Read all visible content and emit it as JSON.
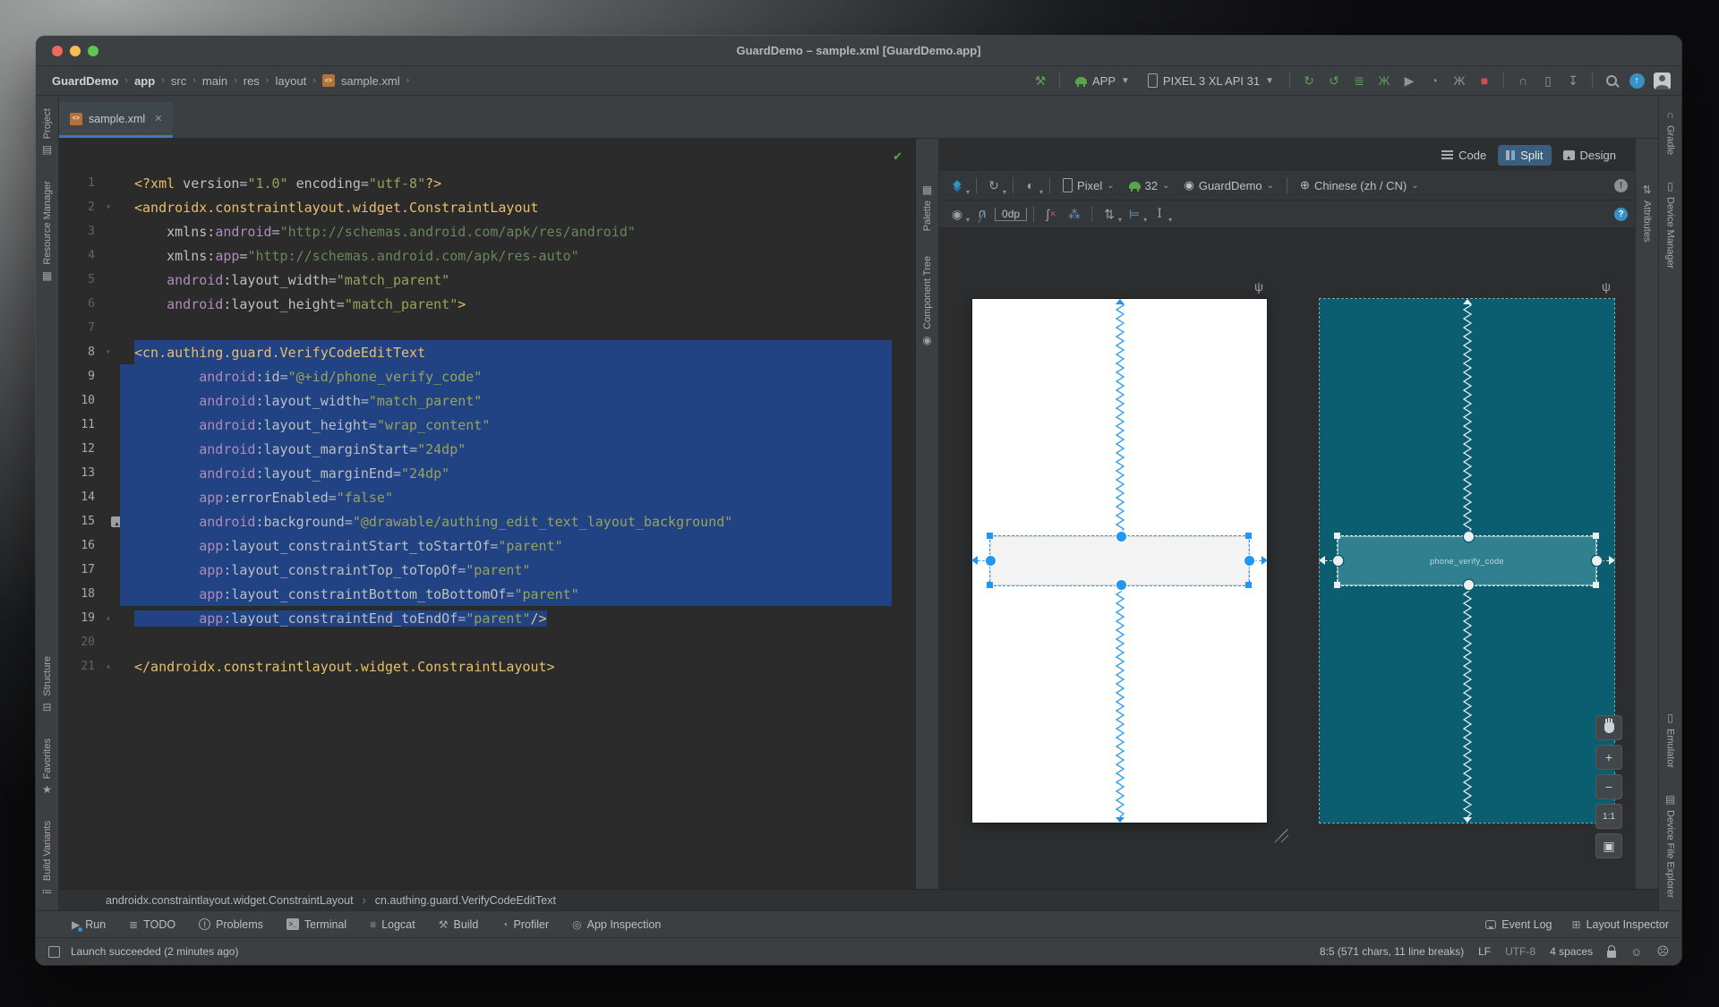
{
  "window": {
    "title": "GuardDemo – sample.xml [GuardDemo.app]"
  },
  "nav": {
    "path": [
      "GuardDemo",
      "app",
      "src",
      "main",
      "res",
      "layout",
      "sample.xml"
    ],
    "config_label": "APP",
    "device_label": "PIXEL 3 XL API 31",
    "actions": [
      {
        "name": "rerun",
        "glyph": "↻",
        "color": "#5ca05a"
      },
      {
        "name": "apply-changes",
        "glyph": "↺",
        "color": "#5ca05a"
      },
      {
        "name": "apply-code-changes",
        "glyph": "≣",
        "color": "#5ca05a"
      },
      {
        "name": "debug",
        "glyph": "Ж",
        "color": "#5ca05a"
      },
      {
        "name": "run-with-coverage",
        "glyph": "▶",
        "color": "#8c9496"
      },
      {
        "name": "profiler",
        "glyph": "◔",
        "color": "#6a8fbf"
      },
      {
        "name": "attach-debugger",
        "glyph": "Ж",
        "color": "#8c9496"
      },
      {
        "name": "stop",
        "glyph": "■",
        "color": "#c75450"
      },
      {
        "name": "sep"
      },
      {
        "name": "sync-project-gradle",
        "glyph": "∩",
        "color": "#8c9496"
      },
      {
        "name": "device-manager",
        "glyph": "▯",
        "color": "#8c9496"
      },
      {
        "name": "sdk-manager",
        "glyph": "↧",
        "color": "#8c9496"
      },
      {
        "name": "sep"
      },
      {
        "name": "search-everywhere",
        "css": "mag"
      },
      {
        "name": "ide-update",
        "css": "update"
      },
      {
        "name": "profile-avatar",
        "css": "avatar"
      }
    ]
  },
  "tab": {
    "label": "sample.xml"
  },
  "view_toggle": {
    "code": "Code",
    "split": "Split",
    "design": "Design"
  },
  "design": {
    "device": "Pixel",
    "api": "32",
    "theme": "GuardDemo",
    "locale": "Chinese (zh / CN)",
    "margin": "0dp",
    "error_badge": "!",
    "help_badge": "?",
    "widget_id": "phone_verify_code",
    "zoom": {
      "in": "+",
      "out": "−",
      "ratio": "1:1"
    },
    "colors": {
      "night_phone": "#0b5d70",
      "night_widget": "#30808f",
      "day_phone": "#ffffff",
      "day_widget": "#f3f3f4",
      "handle_blue": "#2196f3",
      "handle_light": "#eceff1"
    }
  },
  "strips": {
    "left_top": [
      {
        "name": "project",
        "label": "Project",
        "glyph": "▤"
      },
      {
        "name": "resource-manager",
        "label": "Resource Manager",
        "glyph": "▦"
      }
    ],
    "left_bottom": [
      {
        "name": "structure",
        "label": "Structure",
        "glyph": "⊟"
      },
      {
        "name": "favorites",
        "label": "Favorites",
        "glyph": "★"
      },
      {
        "name": "build-variants",
        "label": "Build Variants",
        "glyph": "≔"
      }
    ],
    "right_top": [
      {
        "name": "gradle",
        "label": "Gradle",
        "glyph": "∩"
      },
      {
        "name": "device-manager",
        "label": "Device Manager",
        "glyph": "▯"
      }
    ],
    "right_bottom": [
      {
        "name": "emulator",
        "label": "Emulator",
        "glyph": "▯"
      },
      {
        "name": "device-file-explorer",
        "label": "Device File Explorer",
        "glyph": "▤"
      }
    ],
    "palette": "Palette",
    "component_tree": "Component Tree",
    "attributes": "Attributes"
  },
  "editor": {
    "crumbs": [
      "androidx.constraintlayout.widget.ConstraintLayout",
      "cn.authing.guard.VerifyCodeEditText"
    ],
    "lines": [
      {
        "n": 1,
        "t": [
          [
            "<?xml",
            "t"
          ],
          [
            " version",
            "a"
          ],
          [
            "=",
            "e"
          ],
          [
            "\"1.0\"",
            "v"
          ],
          [
            " encoding",
            "a"
          ],
          [
            "=",
            "e"
          ],
          [
            "\"utf-8\"",
            "v"
          ],
          [
            "?>",
            "t"
          ]
        ]
      },
      {
        "n": 2,
        "f": "▾",
        "t": [
          [
            "<androidx.constraintlayout.widget.ConstraintLayout",
            "t"
          ]
        ]
      },
      {
        "n": 3,
        "t": [
          [
            "    xmlns:",
            "a"
          ],
          [
            "android",
            "n"
          ],
          [
            "=",
            "e"
          ],
          [
            "\"http://schemas.android.com/apk/res/android\"",
            "s"
          ]
        ]
      },
      {
        "n": 4,
        "t": [
          [
            "    xmlns:",
            "a"
          ],
          [
            "app",
            "n"
          ],
          [
            "=",
            "e"
          ],
          [
            "\"http://schemas.android.com/apk/res-auto\"",
            "s"
          ]
        ]
      },
      {
        "n": 5,
        "t": [
          [
            "    ",
            "p"
          ],
          [
            "android",
            "n"
          ],
          [
            ":layout_width",
            "a"
          ],
          [
            "=",
            "e"
          ],
          [
            "\"match_parent\"",
            "v"
          ]
        ]
      },
      {
        "n": 6,
        "t": [
          [
            "    ",
            "p"
          ],
          [
            "android",
            "n"
          ],
          [
            ":layout_height",
            "a"
          ],
          [
            "=",
            "e"
          ],
          [
            "\"match_parent\"",
            "v"
          ],
          [
            ">",
            "t"
          ]
        ]
      },
      {
        "n": 7,
        "t": []
      },
      {
        "n": 8,
        "sel": "a",
        "g": "bulb",
        "f": "▾",
        "t": [
          [
            "<cn.authing.guard.VerifyCodeEditText",
            "t"
          ]
        ]
      },
      {
        "n": 9,
        "sel": "b",
        "t": [
          [
            "        ",
            "p"
          ],
          [
            "android",
            "n"
          ],
          [
            ":id",
            "a"
          ],
          [
            "=",
            "e"
          ],
          [
            "\"@+id/phone_verify_code\"",
            "v"
          ]
        ]
      },
      {
        "n": 10,
        "sel": "b",
        "t": [
          [
            "        ",
            "p"
          ],
          [
            "android",
            "n"
          ],
          [
            ":layout_width",
            "a"
          ],
          [
            "=",
            "e"
          ],
          [
            "\"match_parent\"",
            "v"
          ]
        ]
      },
      {
        "n": 11,
        "sel": "b",
        "t": [
          [
            "        ",
            "p"
          ],
          [
            "android",
            "n"
          ],
          [
            ":layout_height",
            "a"
          ],
          [
            "=",
            "e"
          ],
          [
            "\"wrap_content\"",
            "v"
          ]
        ]
      },
      {
        "n": 12,
        "sel": "b",
        "t": [
          [
            "        ",
            "p"
          ],
          [
            "android",
            "n"
          ],
          [
            ":layout_marginStart",
            "a"
          ],
          [
            "=",
            "e"
          ],
          [
            "\"24dp\"",
            "v"
          ]
        ]
      },
      {
        "n": 13,
        "sel": "b",
        "t": [
          [
            "        ",
            "p"
          ],
          [
            "android",
            "n"
          ],
          [
            ":layout_marginEnd",
            "a"
          ],
          [
            "=",
            "e"
          ],
          [
            "\"24dp\"",
            "v"
          ]
        ]
      },
      {
        "n": 14,
        "sel": "b",
        "t": [
          [
            "        ",
            "p"
          ],
          [
            "app",
            "n"
          ],
          [
            ":errorEnabled",
            "a"
          ],
          [
            "=",
            "e"
          ],
          [
            "\"false\"",
            "v"
          ]
        ]
      },
      {
        "n": 15,
        "sel": "b",
        "g": "img",
        "t": [
          [
            "        ",
            "p"
          ],
          [
            "android",
            "n"
          ],
          [
            ":background",
            "a"
          ],
          [
            "=",
            "e"
          ],
          [
            "\"@drawable/authing_edit_text_layout_background\"",
            "v"
          ]
        ]
      },
      {
        "n": 16,
        "sel": "b",
        "t": [
          [
            "        ",
            "p"
          ],
          [
            "app",
            "n"
          ],
          [
            ":layout_constraintStart_toStartOf",
            "a"
          ],
          [
            "=",
            "e"
          ],
          [
            "\"parent\"",
            "v"
          ]
        ]
      },
      {
        "n": 17,
        "sel": "b",
        "t": [
          [
            "        ",
            "p"
          ],
          [
            "app",
            "n"
          ],
          [
            ":layout_constraintTop_toTopOf",
            "a"
          ],
          [
            "=",
            "e"
          ],
          [
            "\"parent\"",
            "v"
          ]
        ]
      },
      {
        "n": 18,
        "sel": "b",
        "t": [
          [
            "        ",
            "p"
          ],
          [
            "app",
            "n"
          ],
          [
            ":layout_constraintBottom_toBottomOf",
            "a"
          ],
          [
            "=",
            "e"
          ],
          [
            "\"parent\"",
            "v"
          ]
        ]
      },
      {
        "n": 19,
        "sel": "c",
        "f": "▴",
        "t": [
          [
            "        ",
            "p"
          ],
          [
            "app",
            "n"
          ],
          [
            ":layout_constraintEnd_toEndOf",
            "a"
          ],
          [
            "=",
            "e"
          ],
          [
            "\"parent\"",
            "v"
          ],
          [
            "/>",
            "t"
          ]
        ]
      },
      {
        "n": 20,
        "t": []
      },
      {
        "n": 21,
        "f": "▴",
        "t": [
          [
            "</androidx.constraintlayout.widget.ConstraintLayout>",
            "t"
          ]
        ]
      }
    ]
  },
  "bottom_bar": {
    "left": [
      {
        "name": "run",
        "label": "Run"
      },
      {
        "name": "todo",
        "label": "TODO"
      },
      {
        "name": "problems",
        "label": "Problems"
      },
      {
        "name": "terminal",
        "label": "Terminal"
      },
      {
        "name": "logcat",
        "label": "Logcat"
      },
      {
        "name": "build",
        "label": "Build"
      },
      {
        "name": "profiler",
        "label": "Profiler"
      },
      {
        "name": "app-inspection",
        "label": "App Inspection"
      }
    ],
    "right": [
      {
        "name": "event-log",
        "label": "Event Log"
      },
      {
        "name": "layout-inspector",
        "label": "Layout Inspector"
      }
    ]
  },
  "status": {
    "message": "Launch succeeded (2 minutes ago)",
    "caret": "8:5 (571 chars, 11 line breaks)",
    "line_ending": "LF",
    "encoding": "UTF-8",
    "indent": "4 spaces"
  },
  "icons": {
    "todo": "≣",
    "logcat": "≡",
    "build": "⚒",
    "profiler": "◔",
    "app-inspection": "◎",
    "layout-inspector": "⊞",
    "hammer": "⚒",
    "wrench": "ψ",
    "check": "✔"
  }
}
